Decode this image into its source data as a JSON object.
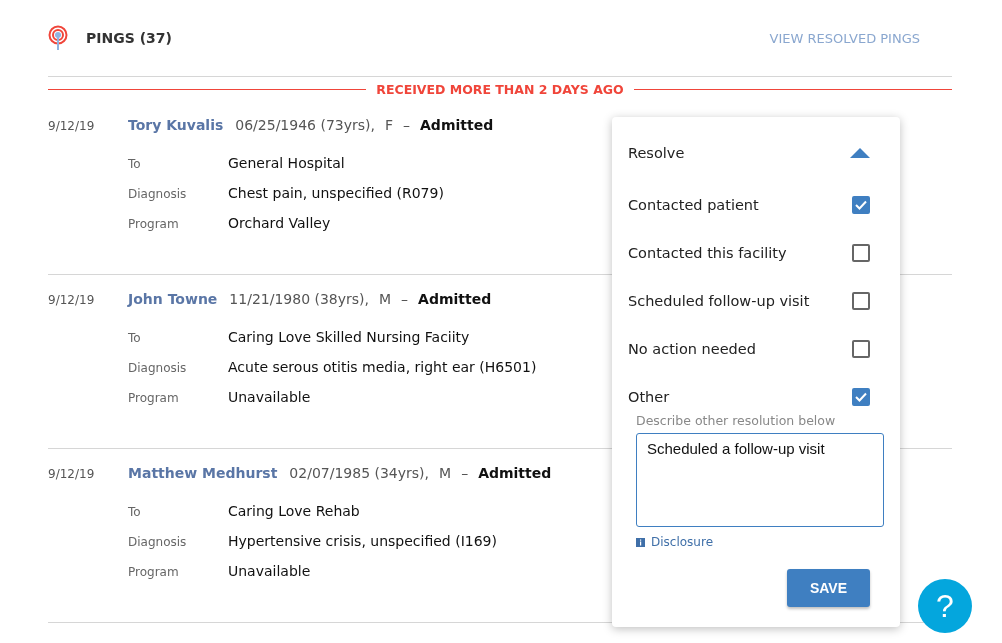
{
  "header": {
    "title": "PINGS (37)",
    "link": "VIEW RESOLVED PINGS"
  },
  "section_label": "RECEIVED MORE THAN 2 DAYS AGO",
  "pings": [
    {
      "date": "9/12/19",
      "name": "Tory Kuvalis",
      "dob": "06/25/1946 (73yrs),",
      "sex": "F",
      "separator": "–",
      "status": "Admitted",
      "details": [
        {
          "label": "To",
          "value": "General Hospital"
        },
        {
          "label": "Diagnosis",
          "value": "Chest pain, unspecified (R079)"
        },
        {
          "label": "Program",
          "value": "Orchard Valley"
        }
      ]
    },
    {
      "date": "9/12/19",
      "name": "John Towne",
      "dob": "11/21/1980 (38yrs),",
      "sex": "M",
      "separator": "–",
      "status": "Admitted",
      "details": [
        {
          "label": "To",
          "value": "Caring Love Skilled Nursing Faciity"
        },
        {
          "label": "Diagnosis",
          "value": "Acute serous otitis media, right ear (H6501)"
        },
        {
          "label": "Program",
          "value": "Unavailable"
        }
      ]
    },
    {
      "date": "9/12/19",
      "name": "Matthew Medhurst",
      "dob": "02/07/1985 (34yrs),",
      "sex": "M",
      "separator": "–",
      "status": "Admitted",
      "details": [
        {
          "label": "To",
          "value": "Caring Love Rehab"
        },
        {
          "label": "Diagnosis",
          "value": "Hypertensive crisis, unspecified (I169)"
        },
        {
          "label": "Program",
          "value": "Unavailable"
        }
      ]
    }
  ],
  "resolve_panel": {
    "title": "Resolve",
    "expanded": true,
    "options": [
      {
        "label": "Contacted patient",
        "checked": true
      },
      {
        "label": "Contacted this facility",
        "checked": false
      },
      {
        "label": "Scheduled follow-up visit",
        "checked": false
      },
      {
        "label": "No action needed",
        "checked": false
      },
      {
        "label": "Other",
        "checked": true
      }
    ],
    "other_label": "Describe other resolution below",
    "other_value": "Scheduled a follow-up visit",
    "disclosure": "Disclosure",
    "save": "SAVE"
  },
  "help_button": "?"
}
